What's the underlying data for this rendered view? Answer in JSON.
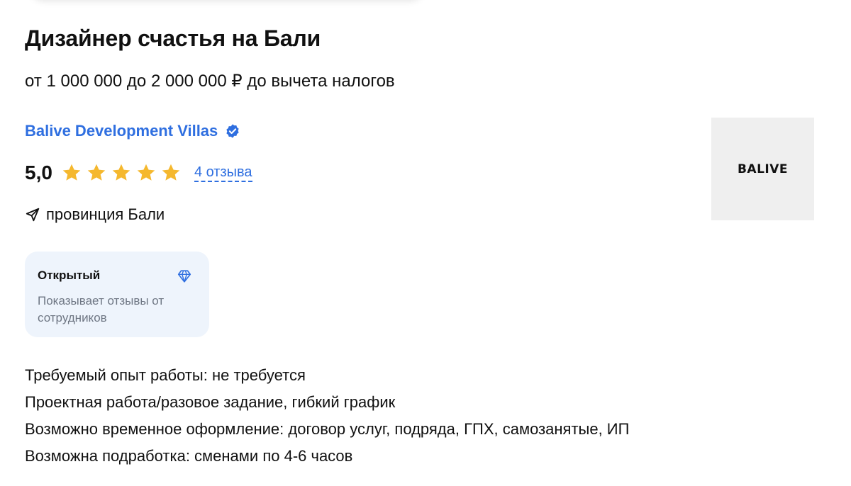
{
  "vacancy": {
    "title": "Дизайнер счастья на Бали",
    "salary": "от 1 000 000 до 2 000 000 ₽ до вычета налогов"
  },
  "company": {
    "name": "Balive Development Villas",
    "verified_icon": "verified-badge-icon",
    "logo_text": "BALIVE",
    "rating": "5,0",
    "stars_count": 5,
    "star_color": "#f5b82e",
    "reviews_link": "4 отзыва",
    "location_icon": "navigation-arrow-icon",
    "location": "провинция Бали"
  },
  "badge": {
    "title": "Открытый",
    "icon": "diamond-icon",
    "description": "Показывает отзывы от сотрудников"
  },
  "details": [
    "Требуемый опыт работы: не требуется",
    "Проектная работа/разовое задание, гибкий график",
    "Возможно временное оформление: договор услуг, подряда, ГПХ, самозанятые, ИП",
    "Возможна подработка: сменами по 4-6 часов"
  ],
  "colors": {
    "accent": "#2f6fe0",
    "badge_background": "#eef4fc",
    "muted_text": "#6e7683",
    "logo_background": "#efefef"
  }
}
